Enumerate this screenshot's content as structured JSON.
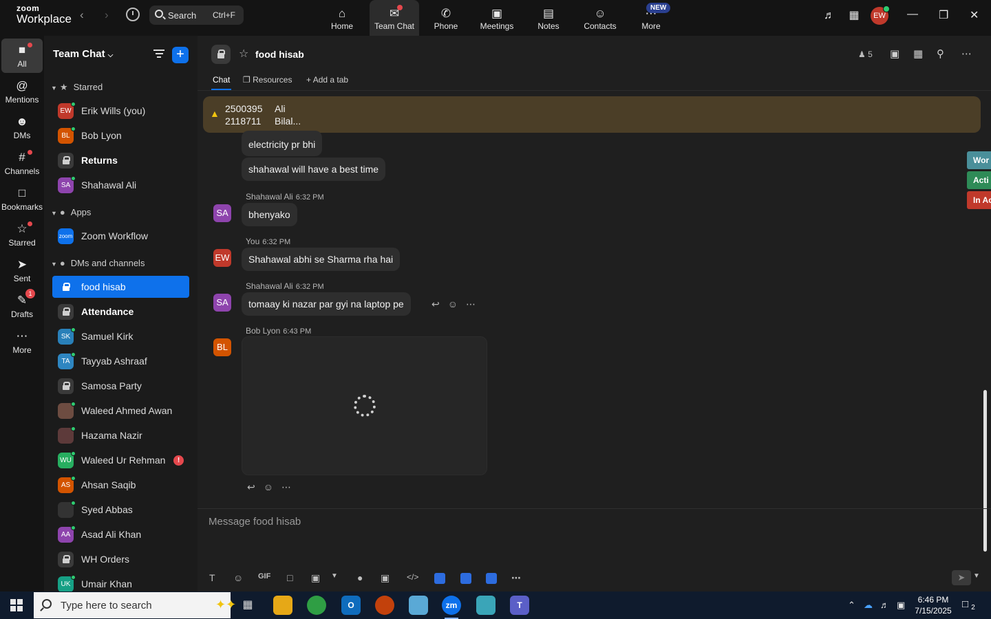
{
  "topbar": {
    "logo_line1": "zoom",
    "logo_line2": "Workplace",
    "search_label": "Search",
    "search_shortcut": "Ctrl+F",
    "nav": [
      {
        "label": "Home",
        "icon": "home-icon"
      },
      {
        "label": "Team Chat",
        "icon": "chat-icon"
      },
      {
        "label": "Phone",
        "icon": "phone-icon"
      },
      {
        "label": "Meetings",
        "icon": "video-icon"
      },
      {
        "label": "Notes",
        "icon": "notes-icon"
      },
      {
        "label": "Contacts",
        "icon": "contacts-icon"
      },
      {
        "label": "More",
        "icon": "more-icon"
      }
    ],
    "new_badge": "NEW",
    "user_initials": "EW"
  },
  "rail": {
    "items": [
      {
        "label": "All",
        "icon": "chat-bubble-icon"
      },
      {
        "label": "Mentions",
        "icon": "at-icon"
      },
      {
        "label": "DMs",
        "icon": "people-icon"
      },
      {
        "label": "Channels",
        "icon": "hash-icon"
      },
      {
        "label": "Bookmarks",
        "icon": "bookmark-icon"
      },
      {
        "label": "Starred",
        "icon": "star-icon"
      },
      {
        "label": "Sent",
        "icon": "send-icon"
      },
      {
        "label": "Drafts",
        "icon": "drafts-icon"
      },
      {
        "label": "More",
        "icon": "ellipsis-icon"
      }
    ],
    "drafts_badge": "1"
  },
  "sidebar": {
    "title": "Team Chat",
    "sections": {
      "starred": "Starred",
      "apps": "Apps",
      "dms": "DMs and channels"
    },
    "starred": [
      {
        "label": "Erik Wills (you)",
        "initials": "EW",
        "color": "#c0392b"
      },
      {
        "label": "Bob Lyon",
        "initials": "BL",
        "color": "#d35400"
      },
      {
        "label": "Returns"
      },
      {
        "label": "Shahawal Ali",
        "initials": "SA",
        "color": "#8e44ad"
      }
    ],
    "apps": [
      {
        "label": "Zoom Workflow",
        "initials": "zoom",
        "color": "#0e71eb"
      }
    ],
    "dms": [
      {
        "label": "food hisab"
      },
      {
        "label": "Attendance"
      },
      {
        "label": "Samuel Kirk",
        "initials": "SK",
        "color": "#2980b9"
      },
      {
        "label": "Tayyab Ashraaf",
        "initials": "TA",
        "color": "#2e86c1"
      },
      {
        "label": "Samosa Party"
      },
      {
        "label": "Waleed Ahmed Awan",
        "initials": "",
        "color": "#6d4c41"
      },
      {
        "label": "Hazama Nazir",
        "initials": "",
        "color": "#5d3a3a"
      },
      {
        "label": "Waleed Ur Rehman",
        "initials": "WU",
        "color": "#27ae60",
        "alert": "!"
      },
      {
        "label": "Ahsan Saqib",
        "initials": "AS",
        "color": "#d35400"
      },
      {
        "label": "Syed Abbas",
        "initials": "",
        "color": "#333333"
      },
      {
        "label": "Asad Ali Khan",
        "initials": "AA",
        "color": "#8e44ad"
      },
      {
        "label": "WH Orders"
      },
      {
        "label": "Umair Khan",
        "initials": "UK",
        "color": "#16a085"
      }
    ]
  },
  "channel": {
    "title": "food hisab",
    "members": "5",
    "tabs": [
      "Chat",
      "Resources",
      "Add a tab"
    ],
    "pinned": {
      "line1_num": "2500395",
      "line1_name": "Ali",
      "line2_num": "2118711",
      "line2_name": "Bilal..."
    },
    "side_tags": [
      {
        "label": "Wor",
        "color": "#4a8f9a"
      },
      {
        "label": "Acti",
        "color": "#2e8b57"
      },
      {
        "label": "In Ac",
        "color": "#c0392b"
      }
    ],
    "messages": [
      {
        "text": "electricity pr bhi"
      },
      {
        "text": "shahawal will have a best time"
      },
      {
        "sender": "Shahawal Ali",
        "time": "6:32 PM",
        "initials": "SA",
        "color": "#8e44ad",
        "text": "bhenyako"
      },
      {
        "sender": "You",
        "time": "6:32 PM",
        "initials": "EW",
        "color": "#c0392b",
        "text": "Shahawal abhi se Sharma rha hai"
      },
      {
        "sender": "Shahawal Ali",
        "time": "6:32 PM",
        "initials": "SA",
        "color": "#8e44ad",
        "text": "tomaay ki nazar par gyi na laptop pe"
      },
      {
        "sender": "Bob Lyon",
        "time": "6:43 PM",
        "initials": "BL",
        "color": "#d35400"
      }
    ],
    "composer_placeholder": "Message food hisab"
  },
  "taskbar": {
    "search_placeholder": "Type here to search",
    "time": "6:46 PM",
    "date": "7/15/2025",
    "notifications": "2"
  }
}
